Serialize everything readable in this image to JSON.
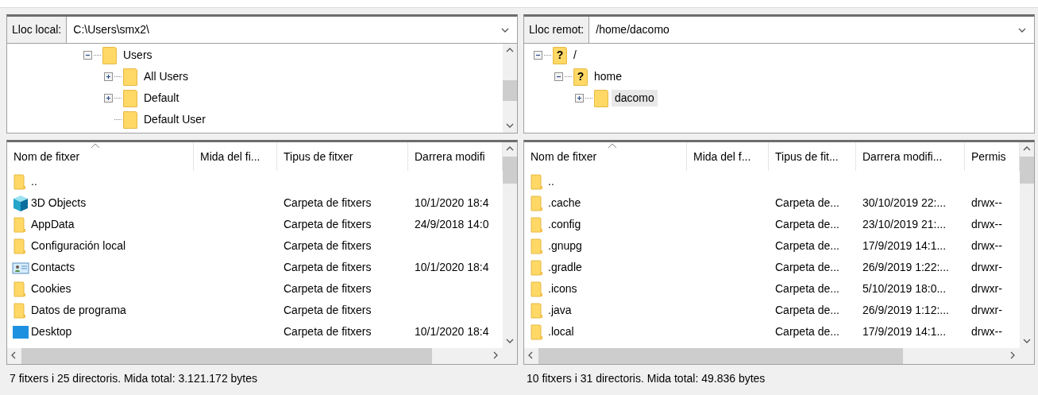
{
  "local": {
    "location_label": "Lloc local:",
    "path": "C:\\Users\\smx2\\",
    "tree_scrollbar": true,
    "tree": [
      {
        "label": "Users",
        "kind": "branch",
        "expanded": true,
        "selected": false,
        "children": [
          {
            "label": "All Users",
            "kind": "branch",
            "expanded": false,
            "selected": false
          },
          {
            "label": "Default",
            "kind": "branch",
            "expanded": false,
            "selected": false
          },
          {
            "label": "Default User",
            "kind": "leaf",
            "selected": false
          }
        ]
      }
    ],
    "columns": [
      {
        "label": "Nom de fitxer",
        "sorted": true
      },
      {
        "label": "Mida del fi...",
        "sorted": false
      },
      {
        "label": "Tipus de fitxer",
        "sorted": false
      },
      {
        "label": "Darrera modifi",
        "sorted": false
      }
    ],
    "rows": [
      {
        "kind": "folder",
        "name": ".."
      },
      {
        "kind": "cube",
        "name": "3D Objects",
        "type": "Carpeta de fitxers",
        "modified": "10/1/2020 18:4"
      },
      {
        "kind": "folder",
        "name": "AppData",
        "type": "Carpeta de fitxers",
        "modified": "24/9/2018 14:0"
      },
      {
        "kind": "folder",
        "name": "Configuración local",
        "type": "Carpeta de fitxers"
      },
      {
        "kind": "contact",
        "name": "Contacts",
        "type": "Carpeta de fitxers",
        "modified": "10/1/2020 18:4"
      },
      {
        "kind": "folder",
        "name": "Cookies",
        "type": "Carpeta de fitxers"
      },
      {
        "kind": "folder",
        "name": "Datos de programa",
        "type": "Carpeta de fitxers"
      },
      {
        "kind": "desktop",
        "name": "Desktop",
        "type": "Carpeta de fitxers",
        "modified": "10/1/2020 18:4"
      }
    ],
    "status": "7 fitxers i 25 directoris. Mida total: 3.121.172 bytes"
  },
  "remote": {
    "location_label": "Lloc remot:",
    "path": "/home/dacomo",
    "tree": [
      {
        "label": "/",
        "badge": "?",
        "kind": "branch",
        "expanded": true,
        "selected": false,
        "children": [
          {
            "label": "home",
            "badge": "?",
            "kind": "branch",
            "expanded": true,
            "selected": false,
            "children": [
              {
                "label": "dacomo",
                "kind": "branch",
                "expanded": false,
                "selected": true
              }
            ]
          }
        ]
      }
    ],
    "columns": [
      {
        "label": "Nom de fitxer",
        "sorted": true
      },
      {
        "label": "Mida del f...",
        "sorted": false
      },
      {
        "label": "Tipus de fit...",
        "sorted": false
      },
      {
        "label": "Darrera modifi...",
        "sorted": false
      },
      {
        "label": "Permis",
        "sorted": false
      }
    ],
    "rows": [
      {
        "kind": "folder",
        "name": ".."
      },
      {
        "kind": "folder",
        "name": ".cache",
        "type": "Carpeta de...",
        "modified": "30/10/2019 22:...",
        "permissions": "drwx--"
      },
      {
        "kind": "folder",
        "name": ".config",
        "type": "Carpeta de...",
        "modified": "23/10/2019 21:...",
        "permissions": "drwx--"
      },
      {
        "kind": "folder",
        "name": ".gnupg",
        "type": "Carpeta de...",
        "modified": "17/9/2019 14:1...",
        "permissions": "drwx--"
      },
      {
        "kind": "folder",
        "name": ".gradle",
        "type": "Carpeta de...",
        "modified": "26/9/2019 1:22:...",
        "permissions": "drwxr-"
      },
      {
        "kind": "folder",
        "name": ".icons",
        "type": "Carpeta de...",
        "modified": "5/10/2019 18:0...",
        "permissions": "drwxr-"
      },
      {
        "kind": "folder",
        "name": ".java",
        "type": "Carpeta de...",
        "modified": "26/9/2019 1:12:...",
        "permissions": "drwxr-"
      },
      {
        "kind": "folder",
        "name": ".local",
        "type": "Carpeta de...",
        "modified": "17/9/2019 14:1...",
        "permissions": "drwx--"
      }
    ],
    "status": "10 fitxers i 31 directoris. Mida total: 49.836 bytes"
  }
}
